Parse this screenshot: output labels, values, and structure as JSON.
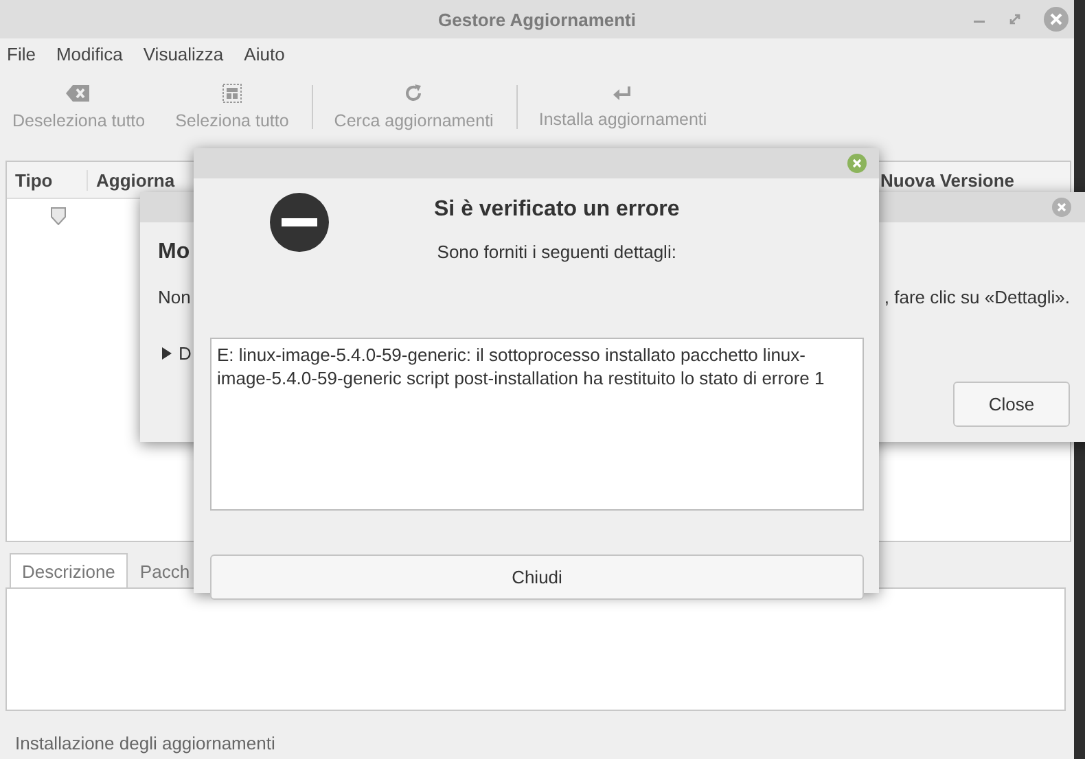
{
  "window": {
    "title": "Gestore Aggiornamenti"
  },
  "menu": [
    "File",
    "Modifica",
    "Visualizza",
    "Aiuto"
  ],
  "toolbar": [
    [
      {
        "label": "Deseleziona tutto",
        "kind": "clear",
        "disabled": true
      },
      {
        "label": "Seleziona tutto",
        "kind": "select",
        "disabled": true
      }
    ],
    [
      {
        "label": "Cerca aggiornamenti",
        "kind": "refresh",
        "disabled": true
      }
    ],
    [
      {
        "label": "Installa aggiornamenti",
        "kind": "install",
        "disabled": true
      }
    ]
  ],
  "table": {
    "columns": [
      "Tipo",
      "Aggiorna",
      "Nuova Versione"
    ]
  },
  "bottom_tabs": [
    {
      "label": "Descrizione",
      "selected": true
    },
    {
      "label": "Pacch",
      "selected": false
    }
  ],
  "status_bar": "Installazione degli aggiornamenti",
  "back_dialog": {
    "heading": "Mo",
    "message_start": "Non",
    "message_end": ", fare clic su «Dettagli».",
    "expander": "D",
    "expanded": false,
    "button": "Close"
  },
  "error_dialog": {
    "title": "Si è verificato un errore",
    "subtitle": "Sono forniti i seguenti dettagli:",
    "details": "E: linux-image-5.4.0-59-generic: il sottoprocesso installato pacchetto linux-image-5.4.0-59-generic script post-installation ha restituito lo stato di errore 1",
    "button": "Chiudi"
  }
}
